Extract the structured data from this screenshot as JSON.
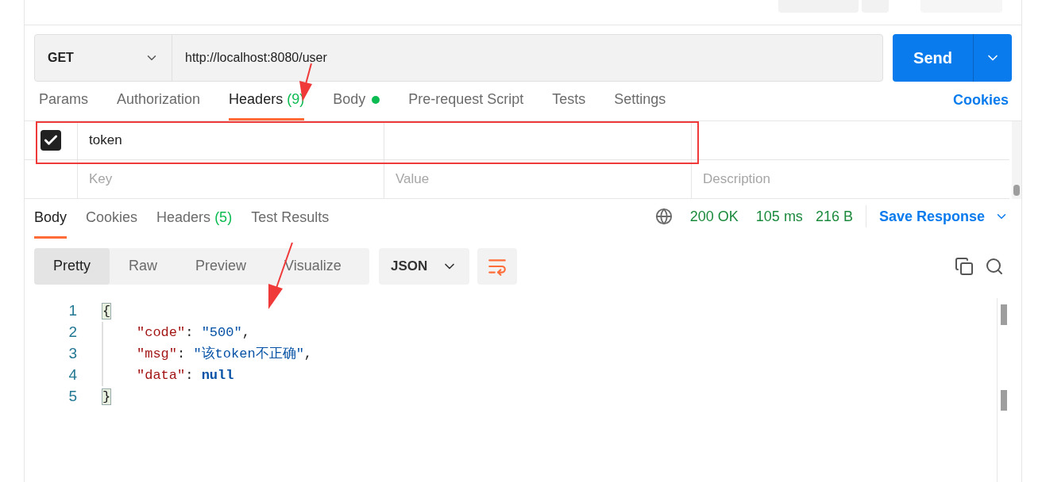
{
  "request": {
    "method": "GET",
    "url": "http://localhost:8080/user",
    "send_label": "Send"
  },
  "request_tabs": [
    {
      "label": "Params",
      "selected": false
    },
    {
      "label": "Authorization",
      "selected": false
    },
    {
      "label": "Headers",
      "count": "(9)",
      "selected": true
    },
    {
      "label": "Body",
      "dot": true,
      "selected": false
    },
    {
      "label": "Pre-request Script",
      "selected": false
    },
    {
      "label": "Tests",
      "selected": false
    },
    {
      "label": "Settings",
      "selected": false
    }
  ],
  "cookies_link": "Cookies",
  "headers_table": {
    "rows": [
      {
        "checked": true,
        "key": "token"
      }
    ],
    "placeholders": {
      "key": "Key",
      "value": "Value",
      "description": "Description"
    }
  },
  "response": {
    "tabs": [
      {
        "label": "Body",
        "selected": true
      },
      {
        "label": "Cookies",
        "selected": false
      },
      {
        "label": "Headers",
        "count": "(5)",
        "selected": false
      },
      {
        "label": "Test Results",
        "selected": false
      }
    ],
    "status": "200 OK",
    "time": "105 ms",
    "size": "216 B",
    "save_label": "Save Response",
    "view_modes": [
      {
        "label": "Pretty",
        "selected": true
      },
      {
        "label": "Raw",
        "selected": false
      },
      {
        "label": "Preview",
        "selected": false
      },
      {
        "label": "Visualize",
        "selected": false
      }
    ],
    "format": "JSON",
    "lines": [
      {
        "number": "1",
        "kind": "brace",
        "tokens": [
          {
            "kind": "brace",
            "text": "{"
          }
        ]
      },
      {
        "number": "2",
        "kind": "member",
        "tokens": [
          {
            "kind": "key",
            "text": "\"code\""
          },
          {
            "kind": "punct",
            "text": ": "
          },
          {
            "kind": "string",
            "text": "\"500\""
          },
          {
            "kind": "punct",
            "text": ","
          }
        ]
      },
      {
        "number": "3",
        "kind": "member",
        "tokens": [
          {
            "kind": "key",
            "text": "\"msg\""
          },
          {
            "kind": "punct",
            "text": ": "
          },
          {
            "kind": "string",
            "text": "\"该token不正确\""
          },
          {
            "kind": "punct",
            "text": ","
          }
        ]
      },
      {
        "number": "4",
        "kind": "member",
        "tokens": [
          {
            "kind": "key",
            "text": "\"data\""
          },
          {
            "kind": "punct",
            "text": ": "
          },
          {
            "kind": "keyword",
            "text": "null"
          }
        ]
      },
      {
        "number": "5",
        "kind": "brace",
        "tokens": [
          {
            "kind": "brace",
            "text": "}"
          }
        ]
      }
    ]
  }
}
